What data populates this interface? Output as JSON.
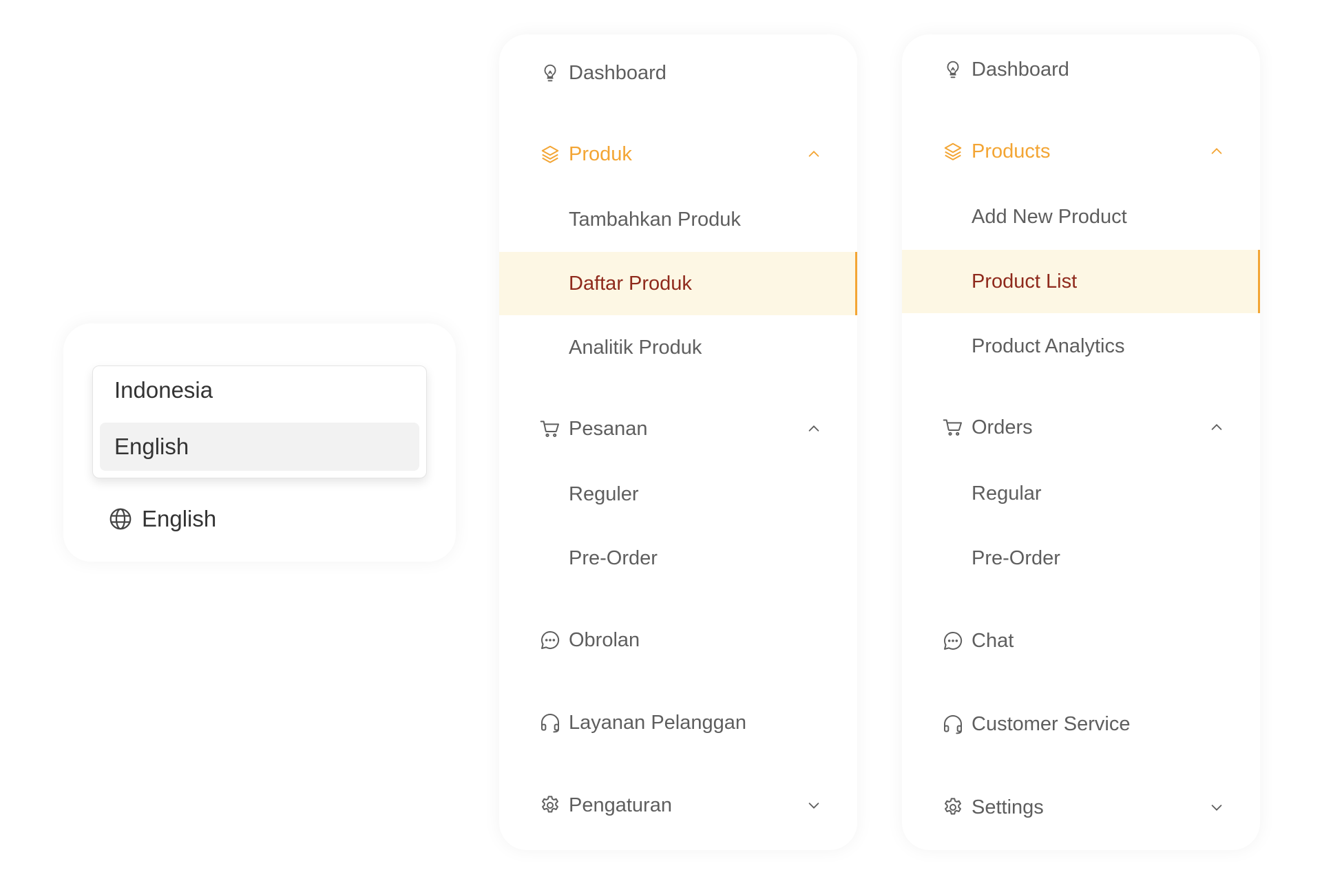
{
  "language_picker": {
    "options": [
      "Indonesia",
      "English"
    ],
    "highlighted_option": "English",
    "current_label": "English",
    "icon": "globe-icon"
  },
  "sidebar_id": {
    "dashboard": "Dashboard",
    "products": {
      "label": "Produk",
      "expanded": true,
      "items": [
        "Tambahkan Produk",
        "Daftar Produk",
        "Analitik Produk"
      ],
      "selected": "Daftar Produk"
    },
    "orders": {
      "label": "Pesanan",
      "expanded": true,
      "items": [
        "Reguler",
        "Pre-Order"
      ]
    },
    "chat": "Obrolan",
    "customer_service": "Layanan Pelanggan",
    "settings": "Pengaturan"
  },
  "sidebar_en": {
    "dashboard": "Dashboard",
    "products": {
      "label": "Products",
      "expanded": true,
      "items": [
        "Add New Product",
        "Product List",
        "Product Analytics"
      ],
      "selected": "Product List"
    },
    "orders": {
      "label": "Orders",
      "expanded": true,
      "items": [
        "Regular",
        "Pre-Order"
      ]
    },
    "chat": "Chat",
    "customer_service": "Customer Service",
    "settings": "Settings"
  },
  "colors": {
    "accent": "#f3a534",
    "selected_bg": "#fdf7e4",
    "selected_text": "#8f2a1c",
    "text": "#5e5e5e"
  }
}
